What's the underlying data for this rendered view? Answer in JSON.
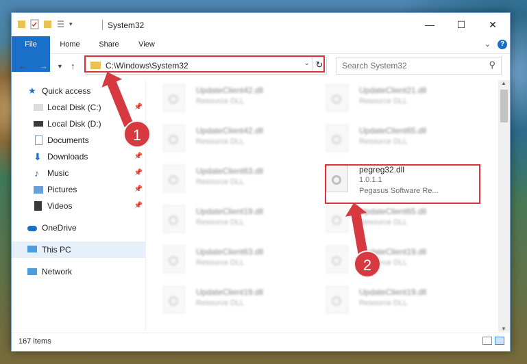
{
  "window": {
    "title": "System32"
  },
  "ribbon": {
    "tabs": [
      "File",
      "Home",
      "Share",
      "View"
    ]
  },
  "address": {
    "path": "C:\\Windows\\System32"
  },
  "search": {
    "placeholder": "Search System32"
  },
  "sidebar": {
    "items": [
      {
        "label": "Quick access",
        "icon": "star-icon"
      },
      {
        "label": "Local Disk (C:)",
        "icon": "drive-icon",
        "pinned": true
      },
      {
        "label": "Local Disk (D:)",
        "icon": "drive-icon"
      },
      {
        "label": "Documents",
        "icon": "document-icon"
      },
      {
        "label": "Downloads",
        "icon": "download-icon",
        "pinned": true
      },
      {
        "label": "Music",
        "icon": "music-icon",
        "pinned": true
      },
      {
        "label": "Pictures",
        "icon": "pictures-icon",
        "pinned": true
      },
      {
        "label": "Videos",
        "icon": "videos-icon",
        "pinned": true
      },
      {
        "label": "OneDrive",
        "icon": "cloud-icon"
      },
      {
        "label": "This PC",
        "icon": "computer-icon",
        "selected": true
      },
      {
        "label": "Network",
        "icon": "network-icon"
      }
    ]
  },
  "files": [
    {
      "name": "UpdateClient42.dll",
      "type": "Resource DLL"
    },
    {
      "name": "UpdateClient21.dll",
      "type": "Resource DLL"
    },
    {
      "name": "UpdateClient42.dll",
      "type": "Resource DLL"
    },
    {
      "name": "UpdateClient65.dll",
      "type": "Resource DLL"
    },
    {
      "name": "UpdateClient63.dll",
      "type": "Resource DLL"
    },
    {
      "name": "pegreg32.dll",
      "version": "1.0.1.1",
      "company": "Pegasus Software Re..."
    },
    {
      "name": "UpdateClient19.dll",
      "type": "Resource DLL"
    },
    {
      "name": "UpdateClient65.dll",
      "type": "Resource DLL"
    },
    {
      "name": "UpdateClient63.dll",
      "type": "Resource DLL"
    },
    {
      "name": "UpdateClient19.dll",
      "type": "Resource DLL"
    },
    {
      "name": "UpdateClient19.dll",
      "type": "Resource DLL"
    },
    {
      "name": "UpdateClient19.dll",
      "type": "Resource DLL"
    }
  ],
  "status": {
    "item_count": "167 items"
  },
  "annotations": {
    "step1": "1",
    "step2": "2"
  },
  "colors": {
    "accent": "#1a6fc9",
    "highlight": "#d9343c"
  }
}
